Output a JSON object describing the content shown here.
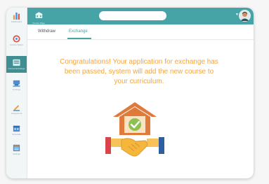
{
  "header": {
    "brand_label": "Course Page",
    "search_value": ""
  },
  "sidebar": {
    "items": [
      {
        "label": "Dashboard",
        "icon": "bar-chart-icon"
      },
      {
        "label": "Course Select",
        "icon": "target-icon"
      },
      {
        "label": "Course Exchange",
        "icon": "exchange-icon"
      },
      {
        "label": "Courses",
        "icon": "course-icon"
      },
      {
        "label": "Assignment",
        "icon": "pencil-icon"
      },
      {
        "label": "Schedule",
        "icon": "calendar-icon"
      },
      {
        "label": "Settings",
        "icon": "form-icon"
      }
    ]
  },
  "tabs": [
    {
      "label": "Withdraw",
      "active": false
    },
    {
      "label": "Exchange",
      "active": true
    }
  ],
  "main": {
    "message": "Congratulations! Your application for exchange has been passed, system will add the new course to your curriculum."
  },
  "colors": {
    "accent": "#46a3a6",
    "message": "#f5a53b",
    "house": "#e07a3a",
    "handshake": "#f5b63c"
  }
}
